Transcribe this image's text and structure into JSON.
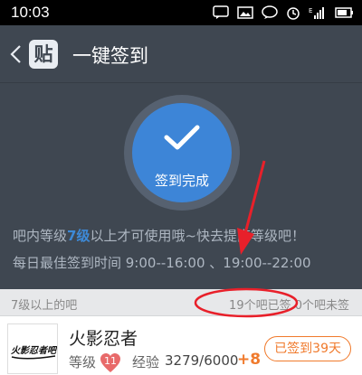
{
  "status_bar": {
    "time": "10:03"
  },
  "header": {
    "logo_char": "贴",
    "title": "一键签到"
  },
  "signin": {
    "done_label": "签到完成",
    "info_prefix": "吧内等级",
    "info_level": "7级",
    "info_suffix": "以上才可使用哦~快去提高等级吧！",
    "best_time": "每日最佳签到时间  9:00--16:00 、19:00--22:00"
  },
  "section": {
    "title": "7级以上的吧",
    "summary": "19个吧已签  0个吧未签"
  },
  "forums": [
    {
      "name": "火影忍者",
      "level_label": "等级",
      "level": "11",
      "exp_label": "经验",
      "exp": "3279/6000",
      "exp_gain": "+8",
      "status": "已签到39天",
      "avatar_text": "火影忍者吧"
    }
  ],
  "colors": {
    "accent": "#3d85d7",
    "orange": "#f07a2c",
    "annotation": "#e8202a"
  }
}
